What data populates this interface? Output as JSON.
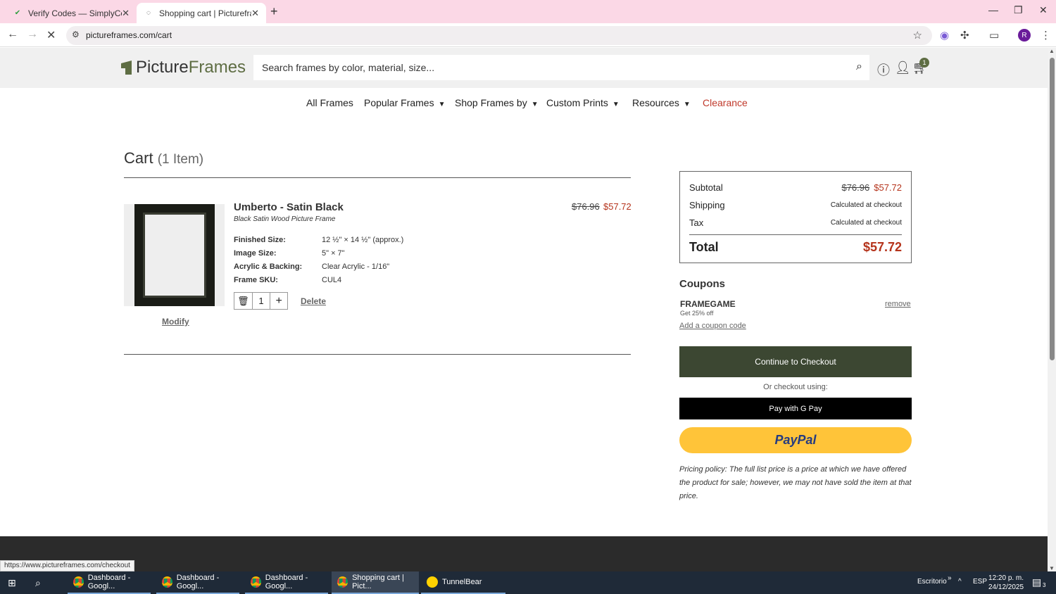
{
  "browser": {
    "tabs": [
      {
        "title": "Verify Codes — SimplyCodes",
        "active": false
      },
      {
        "title": "Shopping cart | Pictureframes.c",
        "active": true
      }
    ],
    "url": "pictureframes.com/cart",
    "status_url": "https://www.pictureframes.com/checkout",
    "profile_initial": "R"
  },
  "site": {
    "logo_part1": "Picture",
    "logo_part2": "Frames",
    "search_placeholder": "Search frames by color, material, size...",
    "cart_count": "1",
    "nav": {
      "all_frames": "All Frames",
      "popular_frames": "Popular Frames",
      "shop_frames_by": "Shop Frames by",
      "custom_prints": "Custom Prints",
      "resources": "Resources",
      "clearance": "Clearance"
    }
  },
  "cart": {
    "title": "Cart",
    "count_label": "(1 Item)",
    "item": {
      "name": "Umberto - Satin Black",
      "subtitle": "Black Satin Wood Picture Frame",
      "specs": [
        {
          "label": "Finished Size:",
          "value": "12 ½\" × 14 ½\" (approx.)"
        },
        {
          "label": "Image Size:",
          "value": "5\" × 7\""
        },
        {
          "label": "Acrylic & Backing:",
          "value": "Clear Acrylic - 1/16\""
        },
        {
          "label": "Frame SKU:",
          "value": "CUL4"
        }
      ],
      "old_price": "$76.96",
      "new_price": "$57.72",
      "quantity": "1",
      "modify_label": "Modify",
      "delete_label": "Delete"
    }
  },
  "summary": {
    "subtotal_label": "Subtotal",
    "subtotal_old": "$76.96",
    "subtotal_new": "$57.72",
    "shipping_label": "Shipping",
    "shipping_value": "Calculated at checkout",
    "tax_label": "Tax",
    "tax_value": "Calculated at checkout",
    "total_label": "Total",
    "total_value": "$57.72"
  },
  "coupons": {
    "heading": "Coupons",
    "code": "FRAMEGAME",
    "description": "Get 25% off",
    "remove_label": "remove",
    "add_label": "Add a coupon code"
  },
  "checkout": {
    "continue_label": "Continue to Checkout",
    "or_label": "Or checkout using:",
    "gpay_label": "Pay with G Pay",
    "paypal_label": "PayPal",
    "policy_text": "Pricing policy: The full list price is a price at which we have offered the product for sale; however, we may not have sold the item at that price."
  },
  "taskbar": {
    "apps": [
      {
        "label": "Dashboard - Googl...",
        "active": false
      },
      {
        "label": "Dashboard - Googl...",
        "active": false
      },
      {
        "label": "Dashboard - Googl...",
        "active": false
      },
      {
        "label": "Shopping cart | Pict...",
        "active": true
      },
      {
        "label": "TunnelBear",
        "active": false
      }
    ],
    "desktop_label": "Escritorio",
    "language": "ESP",
    "time": "12:20 p. m.",
    "date": "24/12/2025",
    "notification_count": "3"
  },
  "colors": {
    "brand_green": "#5e6d43",
    "checkout_button": "#3c4732",
    "sale_price": "#b5341c",
    "clearance": "#c0392b",
    "paypal_yellow": "#ffc439",
    "tab_strip": "#fbd8e6"
  }
}
